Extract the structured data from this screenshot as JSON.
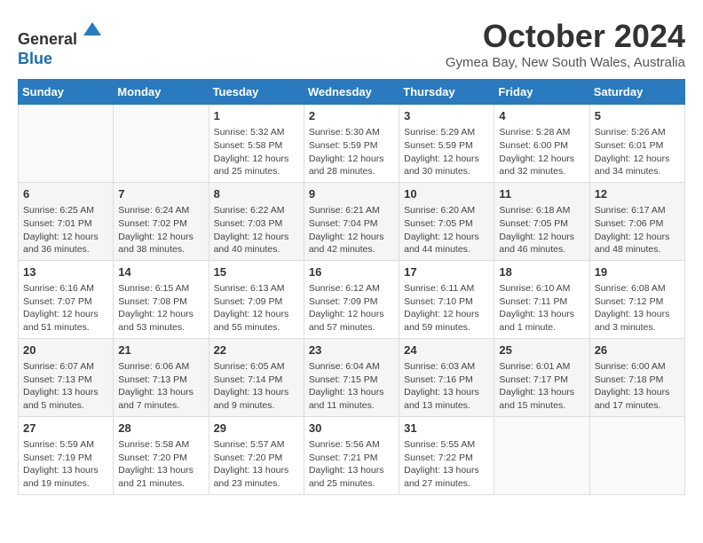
{
  "header": {
    "logo_line1": "General",
    "logo_line2": "Blue",
    "month_title": "October 2024",
    "location": "Gymea Bay, New South Wales, Australia"
  },
  "days_of_week": [
    "Sunday",
    "Monday",
    "Tuesday",
    "Wednesday",
    "Thursday",
    "Friday",
    "Saturday"
  ],
  "weeks": [
    [
      {
        "day": "",
        "content": ""
      },
      {
        "day": "",
        "content": ""
      },
      {
        "day": "1",
        "content": "Sunrise: 5:32 AM\nSunset: 5:58 PM\nDaylight: 12 hours\nand 25 minutes."
      },
      {
        "day": "2",
        "content": "Sunrise: 5:30 AM\nSunset: 5:59 PM\nDaylight: 12 hours\nand 28 minutes."
      },
      {
        "day": "3",
        "content": "Sunrise: 5:29 AM\nSunset: 5:59 PM\nDaylight: 12 hours\nand 30 minutes."
      },
      {
        "day": "4",
        "content": "Sunrise: 5:28 AM\nSunset: 6:00 PM\nDaylight: 12 hours\nand 32 minutes."
      },
      {
        "day": "5",
        "content": "Sunrise: 5:26 AM\nSunset: 6:01 PM\nDaylight: 12 hours\nand 34 minutes."
      }
    ],
    [
      {
        "day": "6",
        "content": "Sunrise: 6:25 AM\nSunset: 7:01 PM\nDaylight: 12 hours\nand 36 minutes."
      },
      {
        "day": "7",
        "content": "Sunrise: 6:24 AM\nSunset: 7:02 PM\nDaylight: 12 hours\nand 38 minutes."
      },
      {
        "day": "8",
        "content": "Sunrise: 6:22 AM\nSunset: 7:03 PM\nDaylight: 12 hours\nand 40 minutes."
      },
      {
        "day": "9",
        "content": "Sunrise: 6:21 AM\nSunset: 7:04 PM\nDaylight: 12 hours\nand 42 minutes."
      },
      {
        "day": "10",
        "content": "Sunrise: 6:20 AM\nSunset: 7:05 PM\nDaylight: 12 hours\nand 44 minutes."
      },
      {
        "day": "11",
        "content": "Sunrise: 6:18 AM\nSunset: 7:05 PM\nDaylight: 12 hours\nand 46 minutes."
      },
      {
        "day": "12",
        "content": "Sunrise: 6:17 AM\nSunset: 7:06 PM\nDaylight: 12 hours\nand 48 minutes."
      }
    ],
    [
      {
        "day": "13",
        "content": "Sunrise: 6:16 AM\nSunset: 7:07 PM\nDaylight: 12 hours\nand 51 minutes."
      },
      {
        "day": "14",
        "content": "Sunrise: 6:15 AM\nSunset: 7:08 PM\nDaylight: 12 hours\nand 53 minutes."
      },
      {
        "day": "15",
        "content": "Sunrise: 6:13 AM\nSunset: 7:09 PM\nDaylight: 12 hours\nand 55 minutes."
      },
      {
        "day": "16",
        "content": "Sunrise: 6:12 AM\nSunset: 7:09 PM\nDaylight: 12 hours\nand 57 minutes."
      },
      {
        "day": "17",
        "content": "Sunrise: 6:11 AM\nSunset: 7:10 PM\nDaylight: 12 hours\nand 59 minutes."
      },
      {
        "day": "18",
        "content": "Sunrise: 6:10 AM\nSunset: 7:11 PM\nDaylight: 13 hours\nand 1 minute."
      },
      {
        "day": "19",
        "content": "Sunrise: 6:08 AM\nSunset: 7:12 PM\nDaylight: 13 hours\nand 3 minutes."
      }
    ],
    [
      {
        "day": "20",
        "content": "Sunrise: 6:07 AM\nSunset: 7:13 PM\nDaylight: 13 hours\nand 5 minutes."
      },
      {
        "day": "21",
        "content": "Sunrise: 6:06 AM\nSunset: 7:13 PM\nDaylight: 13 hours\nand 7 minutes."
      },
      {
        "day": "22",
        "content": "Sunrise: 6:05 AM\nSunset: 7:14 PM\nDaylight: 13 hours\nand 9 minutes."
      },
      {
        "day": "23",
        "content": "Sunrise: 6:04 AM\nSunset: 7:15 PM\nDaylight: 13 hours\nand 11 minutes."
      },
      {
        "day": "24",
        "content": "Sunrise: 6:03 AM\nSunset: 7:16 PM\nDaylight: 13 hours\nand 13 minutes."
      },
      {
        "day": "25",
        "content": "Sunrise: 6:01 AM\nSunset: 7:17 PM\nDaylight: 13 hours\nand 15 minutes."
      },
      {
        "day": "26",
        "content": "Sunrise: 6:00 AM\nSunset: 7:18 PM\nDaylight: 13 hours\nand 17 minutes."
      }
    ],
    [
      {
        "day": "27",
        "content": "Sunrise: 5:59 AM\nSunset: 7:19 PM\nDaylight: 13 hours\nand 19 minutes."
      },
      {
        "day": "28",
        "content": "Sunrise: 5:58 AM\nSunset: 7:20 PM\nDaylight: 13 hours\nand 21 minutes."
      },
      {
        "day": "29",
        "content": "Sunrise: 5:57 AM\nSunset: 7:20 PM\nDaylight: 13 hours\nand 23 minutes."
      },
      {
        "day": "30",
        "content": "Sunrise: 5:56 AM\nSunset: 7:21 PM\nDaylight: 13 hours\nand 25 minutes."
      },
      {
        "day": "31",
        "content": "Sunrise: 5:55 AM\nSunset: 7:22 PM\nDaylight: 13 hours\nand 27 minutes."
      },
      {
        "day": "",
        "content": ""
      },
      {
        "day": "",
        "content": ""
      }
    ]
  ]
}
